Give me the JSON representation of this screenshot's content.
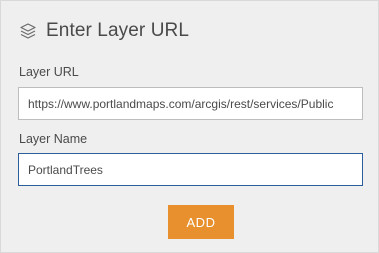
{
  "dialog": {
    "title": "Enter Layer URL",
    "title_icon": "layers-icon"
  },
  "form": {
    "layer_url": {
      "label": "Layer URL",
      "value": "https://www.portlandmaps.com/arcgis/rest/services/Public"
    },
    "layer_name": {
      "label": "Layer Name",
      "value": "PortlandTrees"
    },
    "submit_label": "ADD"
  },
  "colors": {
    "panel_background": "#efefef",
    "accent_button": "#e8902d",
    "focused_border": "#2b5e9a",
    "text": "#4a4a4a"
  }
}
